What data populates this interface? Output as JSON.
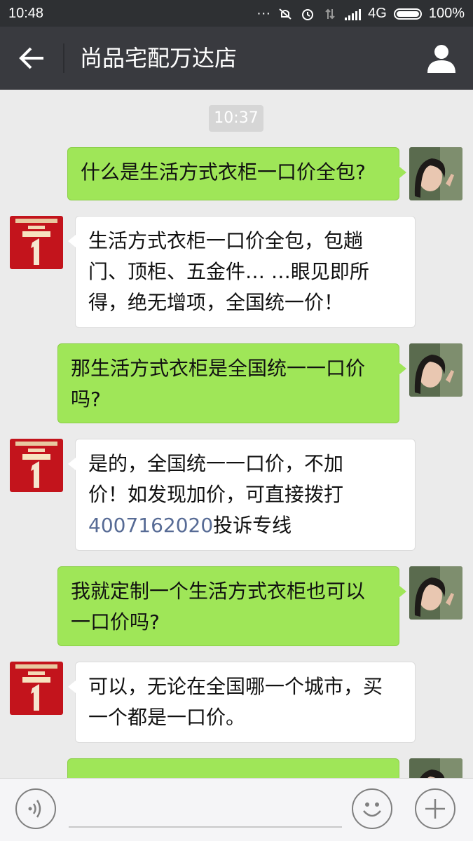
{
  "status_bar": {
    "time": "10:48",
    "network": "4G",
    "battery": "100%"
  },
  "header": {
    "title": "尚品宅配万达店",
    "back_icon": "back-arrow-icon",
    "profile_icon": "person-icon"
  },
  "chat": {
    "timestamp": "10:37",
    "messages": [
      {
        "from": "me",
        "text": "什么是生活方式衣柜一口价全包?"
      },
      {
        "from": "shop",
        "lines": [
          "生活方式衣柜一口价全包，包趟",
          "门、顶柜、五金件… …眼见即所",
          "得，绝无增项，全国统一价！"
        ]
      },
      {
        "from": "me",
        "lines": [
          "那生活方式衣柜是全国统一一口价",
          "吗?"
        ]
      },
      {
        "from": "shop",
        "lines": [
          "是的，全国统一一口价，不加",
          "价！如发现加价，可直接拨打"
        ],
        "phone": "4007162020",
        "suffix": "投诉专线"
      },
      {
        "from": "me",
        "lines": [
          "我就定制一个生活方式衣柜也可以",
          "一口价吗?"
        ]
      },
      {
        "from": "shop",
        "lines": [
          "可以，无论在全国哪一个城市，买",
          "一个都是一口价。"
        ]
      }
    ]
  },
  "input_bar": {
    "voice_icon": "voice-icon",
    "emoji_icon": "emoji-icon",
    "plus_icon": "plus-icon"
  },
  "colors": {
    "titlebar": "#393a3f",
    "my_bubble": "#9fe658",
    "shop_bubble": "#ffffff",
    "link": "#576b95"
  }
}
